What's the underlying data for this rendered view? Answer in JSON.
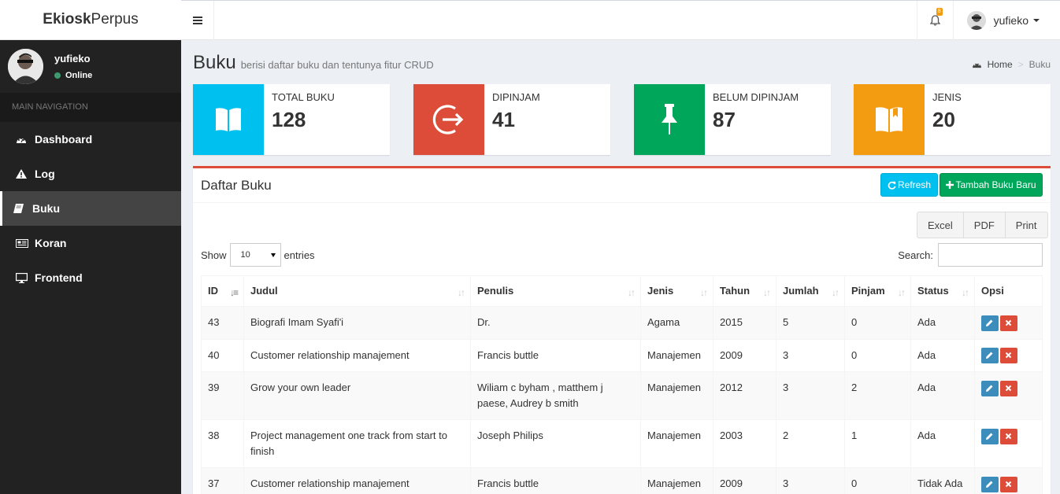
{
  "brand": {
    "bold": "Ekiosk",
    "light": "Perpus"
  },
  "header": {
    "notification_count": "8",
    "user_name": "yufieko"
  },
  "sidebar": {
    "user": {
      "name": "yufieko",
      "status": "Online"
    },
    "nav_header": "MAIN NAVIGATION",
    "items": [
      {
        "label": "Dashboard",
        "icon": "dashboard-icon"
      },
      {
        "label": "Log",
        "icon": "warning-icon"
      },
      {
        "label": "Buku",
        "icon": "book-icon",
        "active": true
      },
      {
        "label": "Koran",
        "icon": "newspaper-icon"
      },
      {
        "label": "Frontend",
        "icon": "desktop-icon"
      }
    ]
  },
  "page": {
    "title": "Buku",
    "subtitle": "berisi daftar buku dan tentunya fitur CRUD",
    "breadcrumb": {
      "home": "Home",
      "current": "Buku"
    }
  },
  "stats": [
    {
      "label": "TOTAL BUKU",
      "value": "128",
      "color": "#00c0ef",
      "icon": "book-open-icon"
    },
    {
      "label": "DIPINJAM",
      "value": "41",
      "color": "#dd4b39",
      "icon": "sign-out-icon"
    },
    {
      "label": "BELUM DIPINJAM",
      "value": "87",
      "color": "#00a65a",
      "icon": "thumbtack-icon"
    },
    {
      "label": "JENIS",
      "value": "20",
      "color": "#f39c12",
      "icon": "bookmark-book-icon"
    }
  ],
  "list": {
    "title": "Daftar Buku",
    "refresh_label": "Refresh",
    "add_label": "Tambah Buku Baru",
    "export_buttons": [
      "Excel",
      "PDF",
      "Print"
    ],
    "show_label": "Show",
    "entries_value": "10",
    "entries_label": "entries",
    "search_label": "Search:",
    "columns": [
      "ID",
      "Judul",
      "Penulis",
      "Jenis",
      "Tahun",
      "Jumlah",
      "Pinjam",
      "Status",
      "Opsi"
    ],
    "rows": [
      [
        "43",
        "Biografi Imam Syafi'i",
        "Dr.",
        "Agama",
        "2015",
        "5",
        "0",
        "Ada"
      ],
      [
        "40",
        "Customer relationship manajement",
        "Francis buttle",
        "Manajemen",
        "2009",
        "3",
        "0",
        "Ada"
      ],
      [
        "39",
        "Grow your own leader",
        "Wiliam c byham , matthem j paese, Audrey b smith",
        "Manajemen",
        "2012",
        "3",
        "2",
        "Ada"
      ],
      [
        "38",
        "Project management one track from start to finish",
        "Joseph Philips",
        "Manajemen",
        "2003",
        "2",
        "1",
        "Ada"
      ],
      [
        "37",
        "Customer relationship manajement",
        "Francis buttle",
        "Manajemen",
        "2009",
        "3",
        "0",
        "Tidak Ada"
      ]
    ]
  }
}
